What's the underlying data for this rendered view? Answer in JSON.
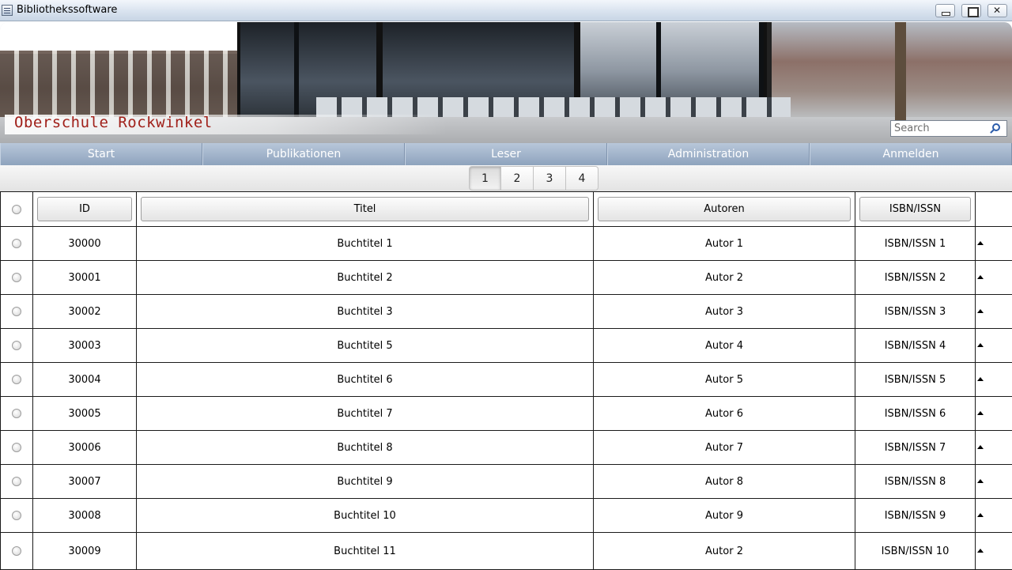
{
  "window": {
    "title": "Bibliothekssoftware"
  },
  "banner": {
    "school_name": "Oberschule Rockwinkel",
    "search_placeholder": "Search"
  },
  "nav": {
    "items": [
      "Start",
      "Publikationen",
      "Leser",
      "Administration",
      "Anmelden"
    ]
  },
  "pager": {
    "pages": [
      "1",
      "2",
      "3",
      "4"
    ],
    "active": "1"
  },
  "table": {
    "columns": [
      "ID",
      "Titel",
      "Autoren",
      "ISBN/ISSN"
    ],
    "rows": [
      {
        "id": "30000",
        "titel": "Buchtitel 1",
        "autoren": "Autor 1",
        "isbn": "ISBN/ISSN 1"
      },
      {
        "id": "30001",
        "titel": "Buchtitel 2",
        "autoren": "Autor 2",
        "isbn": "ISBN/ISSN 2"
      },
      {
        "id": "30002",
        "titel": "Buchtitel 3",
        "autoren": "Autor 3",
        "isbn": "ISBN/ISSN 3"
      },
      {
        "id": "30003",
        "titel": "Buchtitel 5",
        "autoren": "Autor 4",
        "isbn": "ISBN/ISSN 4"
      },
      {
        "id": "30004",
        "titel": "Buchtitel 6",
        "autoren": "Autor 5",
        "isbn": "ISBN/ISSN 5"
      },
      {
        "id": "30005",
        "titel": "Buchtitel 7",
        "autoren": "Autor 6",
        "isbn": "ISBN/ISSN 6"
      },
      {
        "id": "30006",
        "titel": "Buchtitel 8",
        "autoren": "Autor 7",
        "isbn": "ISBN/ISSN 7"
      },
      {
        "id": "30007",
        "titel": "Buchtitel 9",
        "autoren": "Autor 8",
        "isbn": "ISBN/ISSN 8"
      },
      {
        "id": "30008",
        "titel": "Buchtitel 10",
        "autoren": "Autor 9",
        "isbn": "ISBN/ISSN 9"
      },
      {
        "id": "30009",
        "titel": "Buchtitel 11",
        "autoren": "Autor 2",
        "isbn": "ISBN/ISSN 10"
      }
    ]
  },
  "colors": {
    "nav_bg": "#8ea3bd",
    "school_name": "#a0201a"
  },
  "icons": {
    "search": "search-icon",
    "row_action": "caret-up-icon"
  }
}
